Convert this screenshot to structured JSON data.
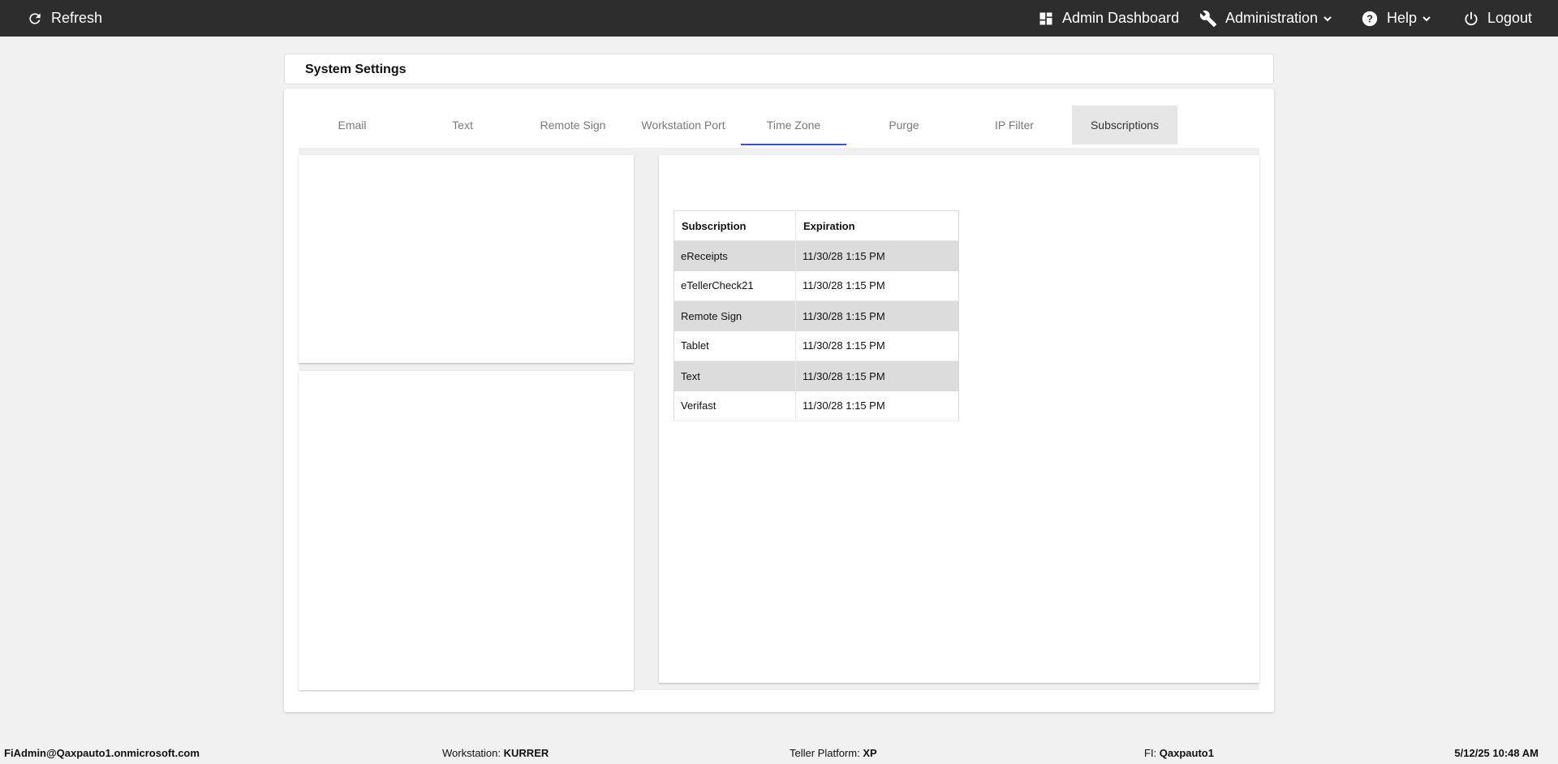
{
  "topbar": {
    "refresh_label": "Refresh",
    "admin_dashboard_label": "Admin Dashboard",
    "administration_label": "Administration",
    "help_label": "Help",
    "logout_label": "Logout",
    "bg_color": "#2d2d2d",
    "icons": [
      "refresh-icon",
      "dashboard-icon",
      "wrench-icon",
      "help-icon",
      "power-icon",
      "chevron-down-icon"
    ]
  },
  "page": {
    "title": "System Settings"
  },
  "tabs": [
    {
      "label": "Email"
    },
    {
      "label": "Text"
    },
    {
      "label": "Remote Sign"
    },
    {
      "label": "Workstation Port"
    },
    {
      "label": "Time Zone"
    },
    {
      "label": "Purge"
    },
    {
      "label": "IP Filter"
    },
    {
      "label": "Subscriptions"
    }
  ],
  "tab_state": {
    "underlined": "Time Zone",
    "selected": "Subscriptions",
    "accent_color": "#3f51b5"
  },
  "subscriptions_table": {
    "columns": [
      "Subscription",
      "Expiration"
    ],
    "rows": [
      {
        "subscription": "eReceipts",
        "expiration": "11/30/28 1:15 PM"
      },
      {
        "subscription": "eTellerCheck21",
        "expiration": "11/30/28 1:15 PM"
      },
      {
        "subscription": "Remote Sign",
        "expiration": "11/30/28 1:15 PM"
      },
      {
        "subscription": "Tablet",
        "expiration": "11/30/28 1:15 PM"
      },
      {
        "subscription": "Text",
        "expiration": "11/30/28 1:15 PM"
      },
      {
        "subscription": "Verifast",
        "expiration": "11/30/28 1:15 PM"
      }
    ]
  },
  "footer": {
    "user": "FiAdmin@Qaxpauto1.onmicrosoft.com",
    "workstation_label": "Workstation:",
    "workstation_value": "KURRER",
    "teller_platform_label": "Teller Platform:",
    "teller_platform_value": "XP",
    "fi_label": "FI:",
    "fi_value": "Qaxpauto1",
    "datetime": "5/12/25 10:48 AM"
  }
}
